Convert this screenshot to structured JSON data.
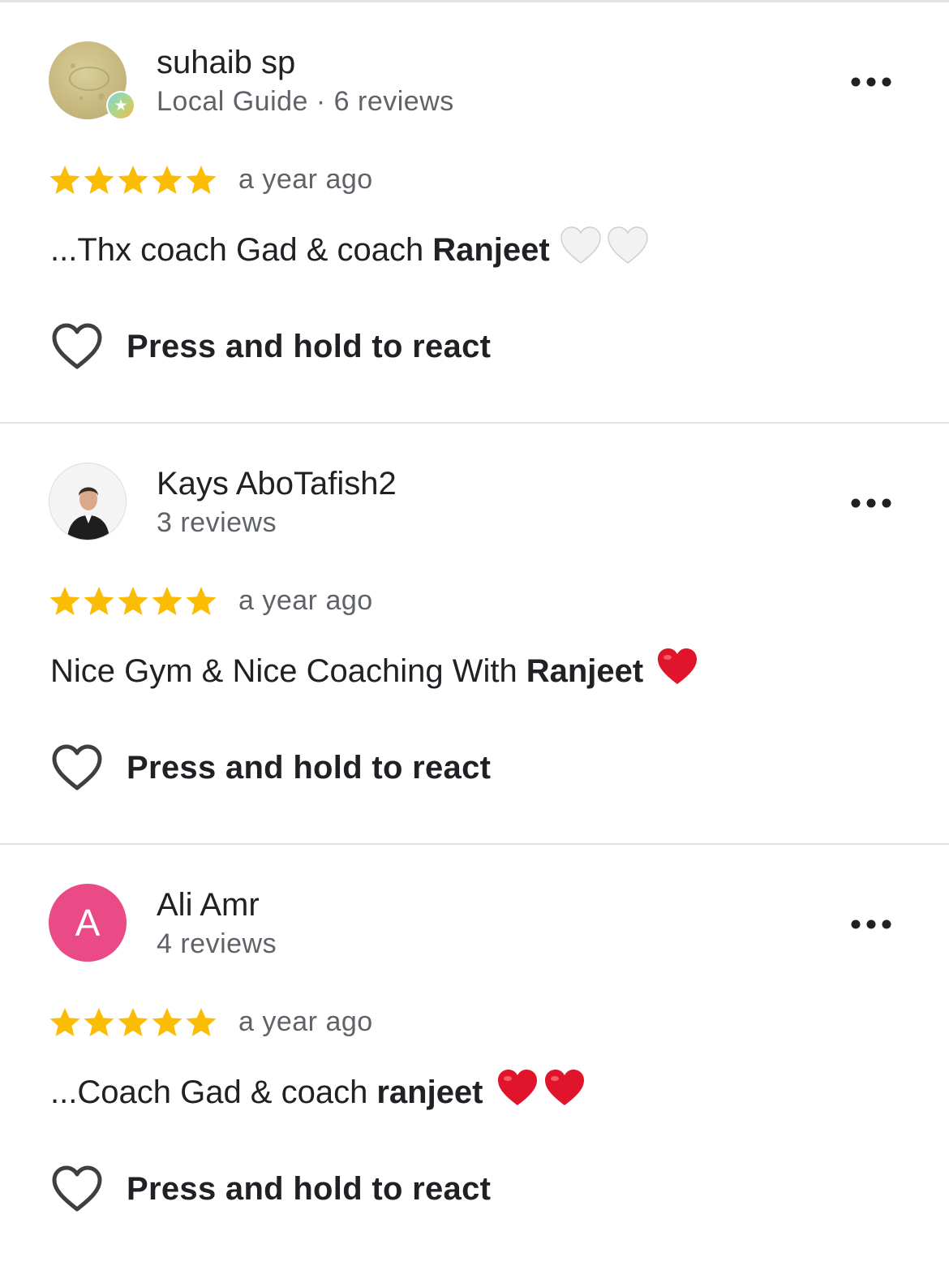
{
  "reviews": [
    {
      "name": "suhaib sp",
      "subline": "Local Guide · 6 reviews",
      "avatar": {
        "type": "photo",
        "description_icon": "local-guide-badge-icon"
      },
      "rating": 5,
      "time": "a year ago",
      "text_prefix": "...Thx coach Gad & coach",
      "text_highlight": "Ranjeet",
      "emoji": [
        "white-heart-icon",
        "white-heart-icon"
      ],
      "react_label": "Press and hold to react"
    },
    {
      "name": "Kays AboTafish2",
      "subline": "3 reviews",
      "avatar": {
        "type": "photo"
      },
      "rating": 5,
      "time": "a year ago",
      "text_prefix": "Nice Gym & Nice Coaching With",
      "text_highlight": "Ranjeet",
      "emoji": [
        "red-heart-icon"
      ],
      "react_label": "Press and hold to react"
    },
    {
      "name": "Ali Amr",
      "subline": "4 reviews",
      "avatar": {
        "type": "letter",
        "letter": "A",
        "color": "#ea4b86"
      },
      "rating": 5,
      "time": "a year ago",
      "text_prefix": "...Coach Gad & coach",
      "text_highlight": "ranjeet",
      "emoji": [
        "red-heart-icon",
        "red-heart-icon"
      ],
      "react_label": "Press and hold to react"
    }
  ],
  "colors": {
    "star": "#fbbc04",
    "secondary_text": "#5f6368",
    "primary_text": "#202124",
    "divider": "#e3e3e3",
    "red_heart": "#e0142b"
  }
}
